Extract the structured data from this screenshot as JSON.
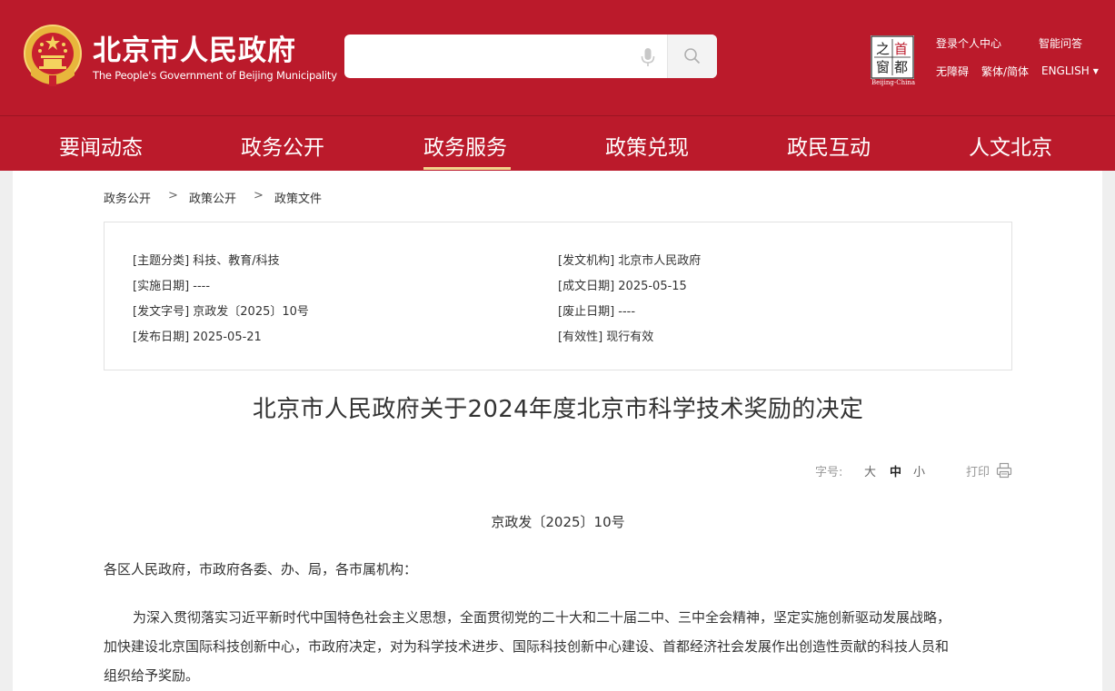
{
  "header": {
    "site_name_cn": "北京市人民政府",
    "site_name_en": "The People's Government of Beijing Municipality",
    "search": {
      "placeholder": ""
    },
    "capital_logo": {
      "chars": [
        "之",
        "首",
        "窗",
        "都"
      ],
      "caption": "Beijing-China"
    },
    "utilities": {
      "login": "登录个人中心",
      "smart_qa": "智能问答",
      "accessibility": "无障碍",
      "traditional_simplified": "繁体/简体",
      "english": "ENGLISH",
      "english_caret": "▼"
    }
  },
  "nav": {
    "items": [
      {
        "label": "要闻动态",
        "active": false
      },
      {
        "label": "政务公开",
        "active": false
      },
      {
        "label": "政务服务",
        "active": true
      },
      {
        "label": "政策兑现",
        "active": false
      },
      {
        "label": "政民互动",
        "active": false
      },
      {
        "label": "人文北京",
        "active": false
      }
    ]
  },
  "breadcrumb": {
    "items": [
      "政务公开",
      "政策公开",
      "政策文件"
    ],
    "separator": ">"
  },
  "meta": {
    "left": [
      "[主题分类] 科技、教育/科技",
      "[实施日期] ----",
      "[发文字号] 京政发〔2025〕10号",
      "[发布日期] 2025-05-21"
    ],
    "right": [
      "[发文机构] 北京市人民政府",
      "[成文日期] 2025-05-15",
      "[废止日期] ----",
      "[有效性] 现行有效"
    ]
  },
  "article": {
    "title": "北京市人民政府关于2024年度北京市科学技术奖励的决定",
    "doc_number": "京政发〔2025〕10号",
    "addressee": "各区人民政府，市政府各委、办、局，各市属机构：",
    "paragraph_lines": [
      "为深入贯彻落实习近平新时代中国特色社会主义思想，全面贯彻党的二十大和二十届二中、三中全会精神，坚定实施创新驱动发展战略，",
      "加快建设北京国际科技创新中心，市政府决定，对为科学技术进步、国际科技创新中心建设、首都经济社会发展作出创造性贡献的科技人员和",
      "组织给予奖励。"
    ]
  },
  "tools": {
    "font_size_label": "字号:",
    "font_sizes": [
      "大",
      "中",
      "小"
    ],
    "font_size_selected": "中",
    "print_label": "打印"
  },
  "colors": {
    "header_red": "#bb1a2b",
    "active_underline": "#f2d38c"
  }
}
